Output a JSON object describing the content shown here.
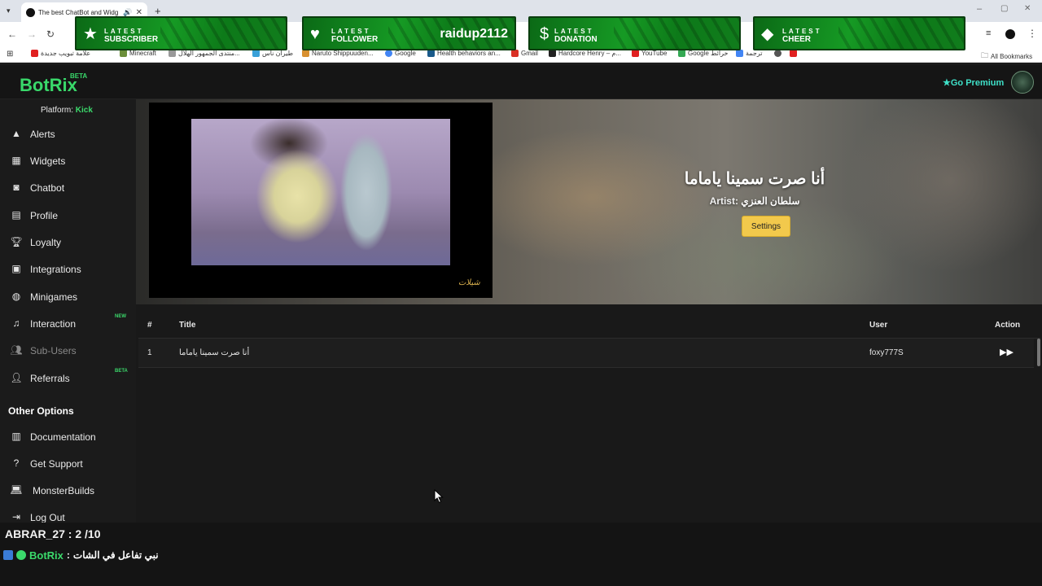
{
  "browser": {
    "tab_title": "The best ChatBot and Widg",
    "bookmarks": [
      "علامة تبويب جديدة",
      "Minecraft",
      "منتدى الجمهور الهلال...",
      "طيران ناس",
      "Naruto Shippuuden...",
      "Google",
      "Health behaviors an...",
      "Gmail",
      "Hardcore Henry – م...",
      "YouTube",
      "Google خرائط",
      "ترجمة"
    ],
    "all_bookmarks": "All Bookmarks"
  },
  "alerts": [
    {
      "top": "LATEST",
      "bottom": "SUBSCRIBER",
      "value": "",
      "icon": "star-icon"
    },
    {
      "top": "LATEST",
      "bottom": "FOLLOWER",
      "value": "raidup2112",
      "icon": "heart-icon"
    },
    {
      "top": "LATEST",
      "bottom": "DONATION",
      "value": "",
      "icon": "dollar-icon"
    },
    {
      "top": "LATEST",
      "bottom": "CHEER",
      "value": "",
      "icon": "diamond-icon"
    }
  ],
  "app": {
    "logo": "BotRix",
    "logo_badge": "BETA",
    "go_premium": "Go Premium",
    "platform_label": "Platform:",
    "platform_value": "Kick"
  },
  "sidebar": {
    "items": [
      {
        "label": "Alerts",
        "icon": "warning-icon",
        "badge": ""
      },
      {
        "label": "Widgets",
        "icon": "widgets-icon",
        "badge": ""
      },
      {
        "label": "Chatbot",
        "icon": "robot-icon",
        "badge": ""
      },
      {
        "label": "Profile",
        "icon": "id-card-icon",
        "badge": ""
      },
      {
        "label": "Loyalty",
        "icon": "trophy-icon",
        "badge": ""
      },
      {
        "label": "Integrations",
        "icon": "integrations-icon",
        "badge": ""
      },
      {
        "label": "Minigames",
        "icon": "gamepad-icon",
        "badge": ""
      },
      {
        "label": "Interaction",
        "icon": "music-icon",
        "badge": "NEW"
      },
      {
        "label": "Sub-Users",
        "icon": "users-icon",
        "badge": ""
      },
      {
        "label": "Referrals",
        "icon": "referrals-icon",
        "badge": "BETA"
      }
    ],
    "other_options_title": "Other Options",
    "other_items": [
      {
        "label": "Documentation",
        "icon": "book-icon"
      },
      {
        "label": "Get Support",
        "icon": "question-icon"
      },
      {
        "label": "MonsterBuilds",
        "icon": "laptop-icon"
      },
      {
        "label": "Log Out",
        "icon": "logout-icon"
      }
    ]
  },
  "now_playing": {
    "title": "أنا صرت سمينا ياماما",
    "artist_label": "Artist:",
    "artist": "سلطان العنزي",
    "settings_button": "Settings"
  },
  "queue": {
    "headers": {
      "num": "#",
      "title": "Title",
      "user": "User",
      "action": "Action"
    },
    "rows": [
      {
        "num": "1",
        "title": "أنا صرت سمينا ياماما",
        "user": "foxy777S"
      }
    ]
  },
  "overlay": {
    "counter": "ABRAR_27 : 2 /10",
    "chat_user": "BotRix",
    "chat_sep": ":",
    "chat_message": "نبي تفاعل في الشات"
  },
  "colors": {
    "accent_green": "#39d86a",
    "premium": "#3fe0c8",
    "settings_button": "#f2c94c"
  }
}
